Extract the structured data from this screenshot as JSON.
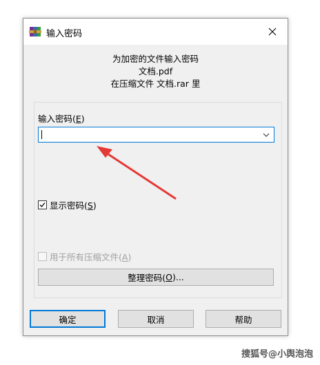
{
  "window": {
    "title": "输入密码",
    "close_symbol": "✕"
  },
  "header": {
    "line1": "为加密的文件输入密码",
    "line2": "文档.pdf",
    "line3": "在压缩文件 文档.rar 里"
  },
  "password": {
    "label_prefix": "输入密码(",
    "label_key": "E",
    "label_suffix": ")",
    "value": ""
  },
  "show_password": {
    "label_prefix": "显示密码(",
    "label_key": "S",
    "label_suffix": ")",
    "checked": true
  },
  "use_for_all": {
    "label_prefix": "用于所有压缩文件(",
    "label_key": "A",
    "label_suffix": ")",
    "checked": false,
    "enabled": false
  },
  "organize_button": {
    "label_prefix": "整理密码(",
    "label_key": "O",
    "label_suffix": ")..."
  },
  "buttons": {
    "ok": "确定",
    "cancel": "取消",
    "help": "帮助"
  },
  "watermark": "搜狐号@小舆泡泡",
  "colors": {
    "accent": "#0078d7",
    "annotation_arrow": "#e53935"
  }
}
